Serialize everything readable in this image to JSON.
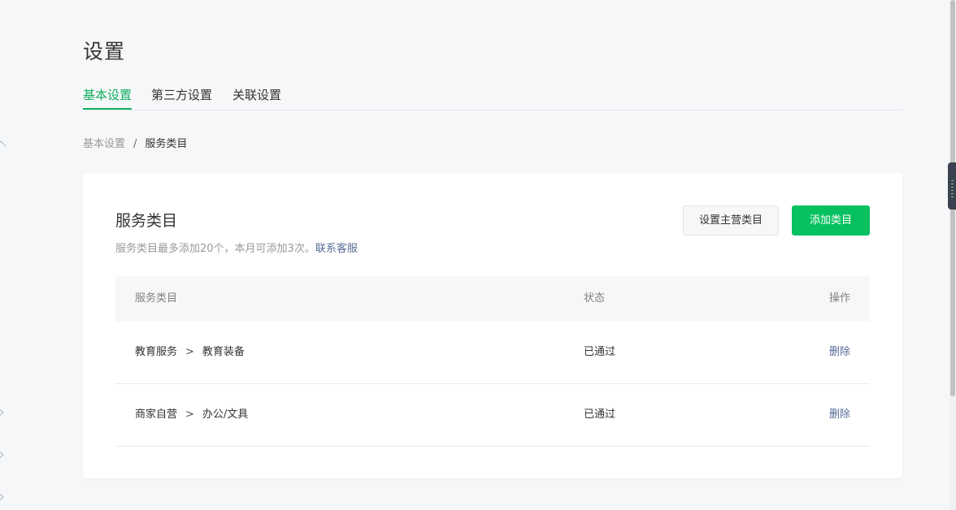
{
  "page_title": "设置",
  "tabs": [
    {
      "label": "基本设置",
      "active": true
    },
    {
      "label": "第三方设置",
      "active": false
    },
    {
      "label": "关联设置",
      "active": false
    }
  ],
  "breadcrumb": {
    "parent": "基本设置",
    "separator": "/",
    "current": "服务类目"
  },
  "card": {
    "title": "服务类目",
    "note": "服务类目最多添加20个，本月可添加3次。",
    "note_link": "联系客服",
    "buttons": {
      "set_main": "设置主营类目",
      "add": "添加类目"
    }
  },
  "table": {
    "headers": [
      "服务类目",
      "状态",
      "操作"
    ],
    "rows": [
      {
        "category": "教育服务",
        "separator": ">",
        "subcategory": "教育装备",
        "status": "已通过",
        "action": "删除"
      },
      {
        "category": "商家自营",
        "separator": ">",
        "subcategory": "办公/文具",
        "status": "已通过",
        "action": "删除"
      }
    ]
  },
  "colors": {
    "accent_green": "#07c160",
    "tab_active": "#10b060",
    "link_blue": "#576b95",
    "background": "#f6f7f9"
  },
  "icons": [
    "chevron-up-icon",
    "chevron-right-icon"
  ]
}
